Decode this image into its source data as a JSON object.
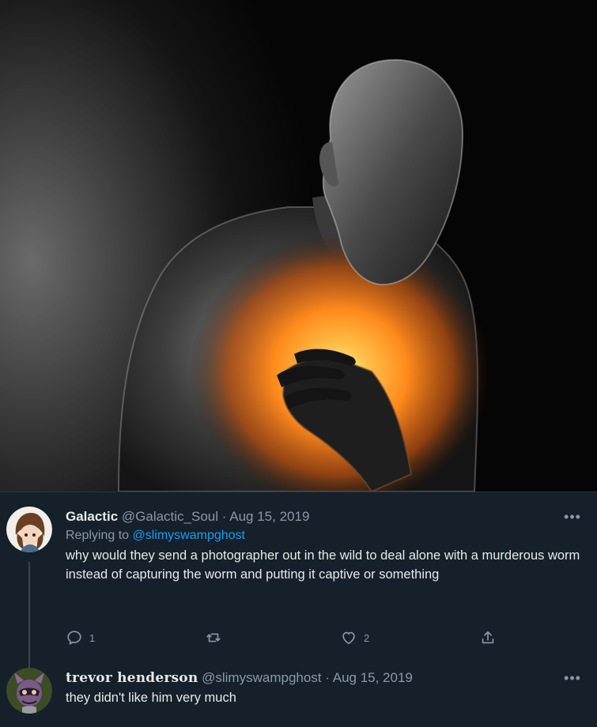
{
  "tweets": [
    {
      "display_name": "Galactic",
      "handle": "@Galactic_Soul",
      "separator": "·",
      "date": "Aug 15, 2019",
      "replying_prefix": "Replying to",
      "replying_to": "@slimyswampghost",
      "text": "why would they send a photographer out in the wild to deal alone with a murderous worm instead of capturing the worm and putting it captive or something",
      "replies": "1",
      "likes": "2",
      "more": "•••"
    },
    {
      "display_name": "trevor henderson",
      "handle": "@slimyswampghost",
      "separator": "·",
      "date": "Aug 15, 2019",
      "text": "they didn't like him very much",
      "more": "•••"
    }
  ],
  "colors": {
    "background": "#15202b",
    "mention": "#1d9bf0",
    "muted": "#8b98a5",
    "glow": "#ff8a1c"
  },
  "icons": [
    "reply-icon",
    "retweet-icon",
    "like-icon",
    "share-icon",
    "more-icon"
  ]
}
